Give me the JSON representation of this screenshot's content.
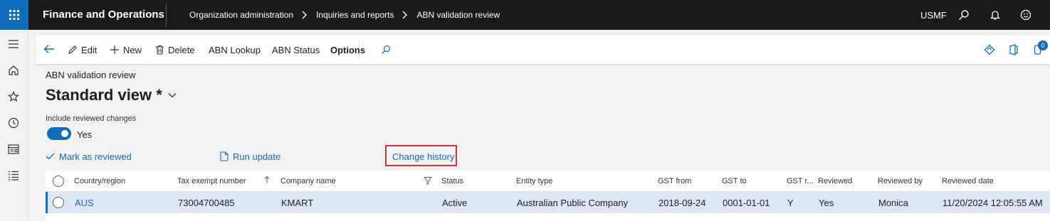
{
  "topbar": {
    "app_title": "Finance and Operations",
    "breadcrumbs": [
      "Organization administration",
      "Inquiries and reports",
      "ABN validation review"
    ],
    "company": "USMF",
    "icons": [
      "waffle-icon",
      "search-icon",
      "bell-icon",
      "smiley-icon"
    ]
  },
  "leftnav": {
    "icons": [
      "hamburger-icon",
      "home-icon",
      "star-icon",
      "clock-icon",
      "workspace-icon",
      "list-icon"
    ]
  },
  "actionpane": {
    "edit": "Edit",
    "new": "New",
    "delete": "Delete",
    "abn_lookup": "ABN Lookup",
    "abn_status": "ABN Status",
    "options": "Options",
    "badge_count": "0"
  },
  "page": {
    "caption": "ABN validation review",
    "view_title": "Standard view *",
    "toggle_label": "Include reviewed changes",
    "toggle_value": "Yes",
    "toggle_on": true
  },
  "actions": {
    "mark_reviewed": "Mark as reviewed",
    "run_update": "Run update",
    "change_history": "Change history"
  },
  "grid": {
    "columns": [
      "Country/region",
      "Tax exempt number",
      "Company name",
      "Status",
      "Entity type",
      "GST from",
      "GST to",
      "GST r...",
      "Reviewed",
      "Reviewed by",
      "Reviewed date"
    ],
    "rows": [
      {
        "country": "AUS",
        "tax_number": "73004700485",
        "company": "KMART",
        "status": "Active",
        "entity_type": "Australian Public Company",
        "gst_from": "2018-09-24",
        "gst_to": "0001-01-01",
        "gst_r": "Y",
        "reviewed": "Yes",
        "reviewed_by": "Monica",
        "reviewed_date": "11/20/2024 12:05:55 AM"
      }
    ]
  },
  "colors": {
    "accent": "#0f6cbd",
    "topbar": "#1b1a19",
    "selected_row": "#dce6f7",
    "highlight_border": "#d13438"
  }
}
